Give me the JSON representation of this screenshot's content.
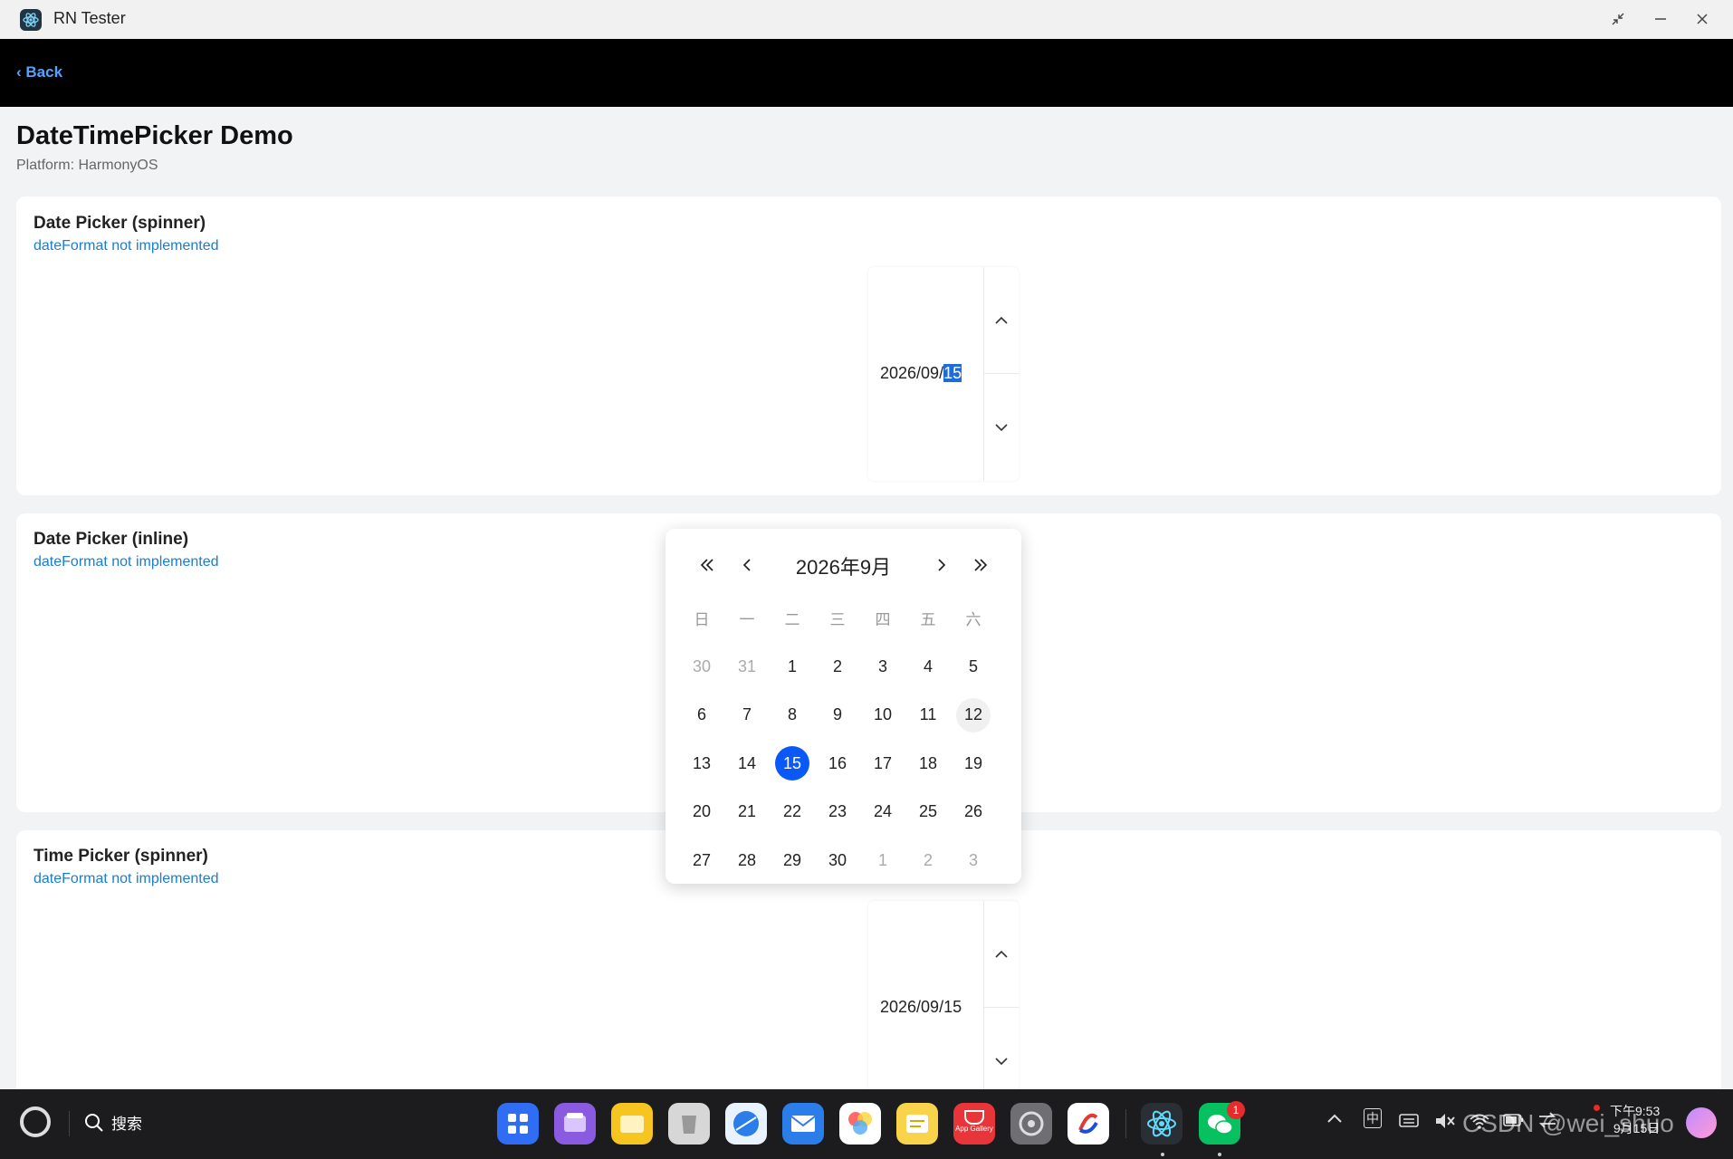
{
  "window": {
    "title": "RN Tester"
  },
  "nav": {
    "back_label": "‹ Back"
  },
  "page": {
    "title": "DateTimePicker Demo",
    "platform": "Platform: HarmonyOS"
  },
  "sections": [
    {
      "title": "Date Picker (spinner)",
      "note": "dateFormat not implemented",
      "value_prefix": "2026/09/",
      "value_selected": "15"
    },
    {
      "title": "Date Picker (inline)",
      "note": "dateFormat not implemented"
    },
    {
      "title": "Time Picker (spinner)",
      "note": "dateFormat not implemented",
      "value": "2026/09/15"
    }
  ],
  "calendar": {
    "month_label": "2026年9月",
    "weekdays": [
      "日",
      "一",
      "二",
      "三",
      "四",
      "五",
      "六"
    ],
    "weeks": [
      [
        "30",
        "31",
        "1",
        "2",
        "3",
        "4",
        "5"
      ],
      [
        "6",
        "7",
        "8",
        "9",
        "10",
        "11",
        "12"
      ],
      [
        "13",
        "14",
        "15",
        "16",
        "17",
        "18",
        "19"
      ],
      [
        "20",
        "21",
        "22",
        "23",
        "24",
        "25",
        "26"
      ],
      [
        "27",
        "28",
        "29",
        "30",
        "1",
        "2",
        "3"
      ]
    ],
    "selected": "15",
    "today": "12",
    "accent": "#0a59f7"
  },
  "taskbar": {
    "search_label": "搜索",
    "apps": [
      "app-grid",
      "files",
      "folder",
      "trash",
      "browser",
      "mail",
      "photos",
      "notes",
      "app-gallery",
      "settings",
      "dev-tools",
      "rn-tester",
      "wechat"
    ],
    "app_gallery_label": "App Gallery",
    "wechat_badge": "1",
    "ime_label": "中",
    "clock_time": "下午9:53",
    "clock_date": "9月15日",
    "watermark": "CSDN @wei_shuo"
  }
}
